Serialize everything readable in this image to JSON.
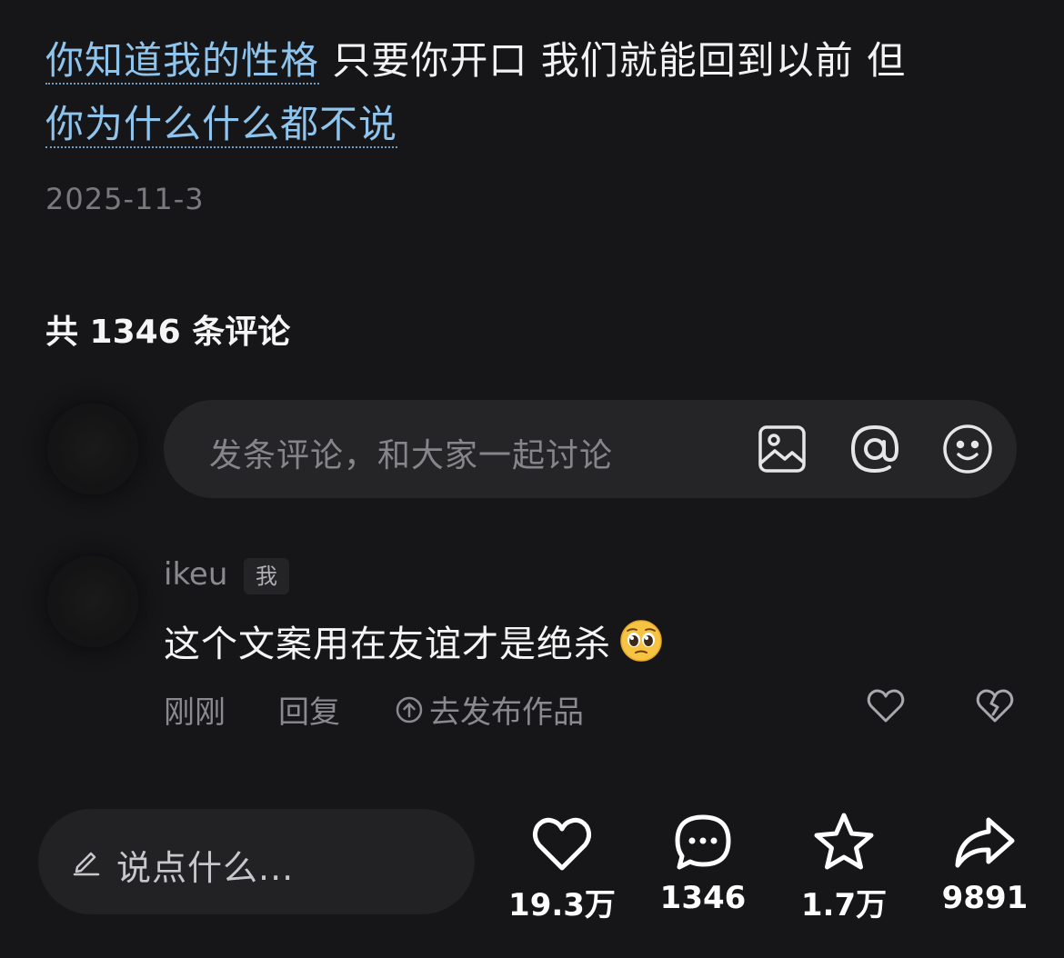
{
  "post": {
    "caption_link_1": "你知道我的性格",
    "caption_plain": " 只要你开口 我们就能回到以前 但",
    "caption_link_2": "你为什么什么都不说",
    "date": "2025-11-3"
  },
  "comments": {
    "count_label": "共 1346 条评论",
    "input_placeholder": "发条评论，和大家一起讨论",
    "input_icons": [
      "image-icon",
      "at-icon",
      "emoji-icon"
    ],
    "items": [
      {
        "username": "ikeu",
        "badge": "我",
        "text": "这个文案用在友谊才是绝杀",
        "emoji": "pleading-face",
        "time": "刚刚",
        "reply_label": "回复",
        "publish_label": "去发布作品"
      }
    ]
  },
  "bottom_bar": {
    "input_placeholder": "说点什么...",
    "likes": "19.3万",
    "comments": "1346",
    "favorites": "1.7万",
    "shares": "9891"
  },
  "colors": {
    "background": "#161619",
    "link": "#8fc4ec",
    "muted": "#8a8a8e",
    "input_bg": "#252528"
  }
}
